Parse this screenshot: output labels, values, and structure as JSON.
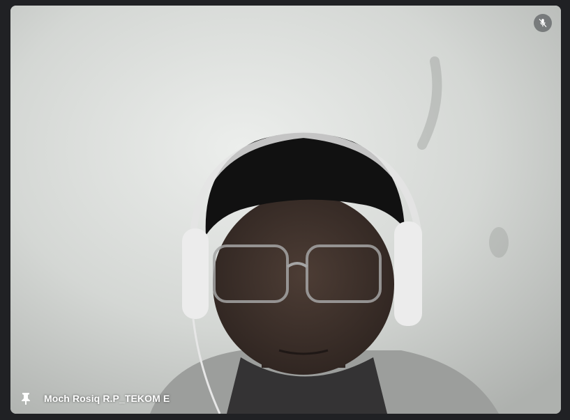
{
  "participant": {
    "name": "Moch Rosiq R.P_TEKOM E",
    "muted": true
  },
  "icons": {
    "mute": "mic-off-icon",
    "pin": "pin-icon"
  },
  "colors": {
    "background": "#202124",
    "indicator": "#3c4043",
    "text": "#ffffff"
  }
}
